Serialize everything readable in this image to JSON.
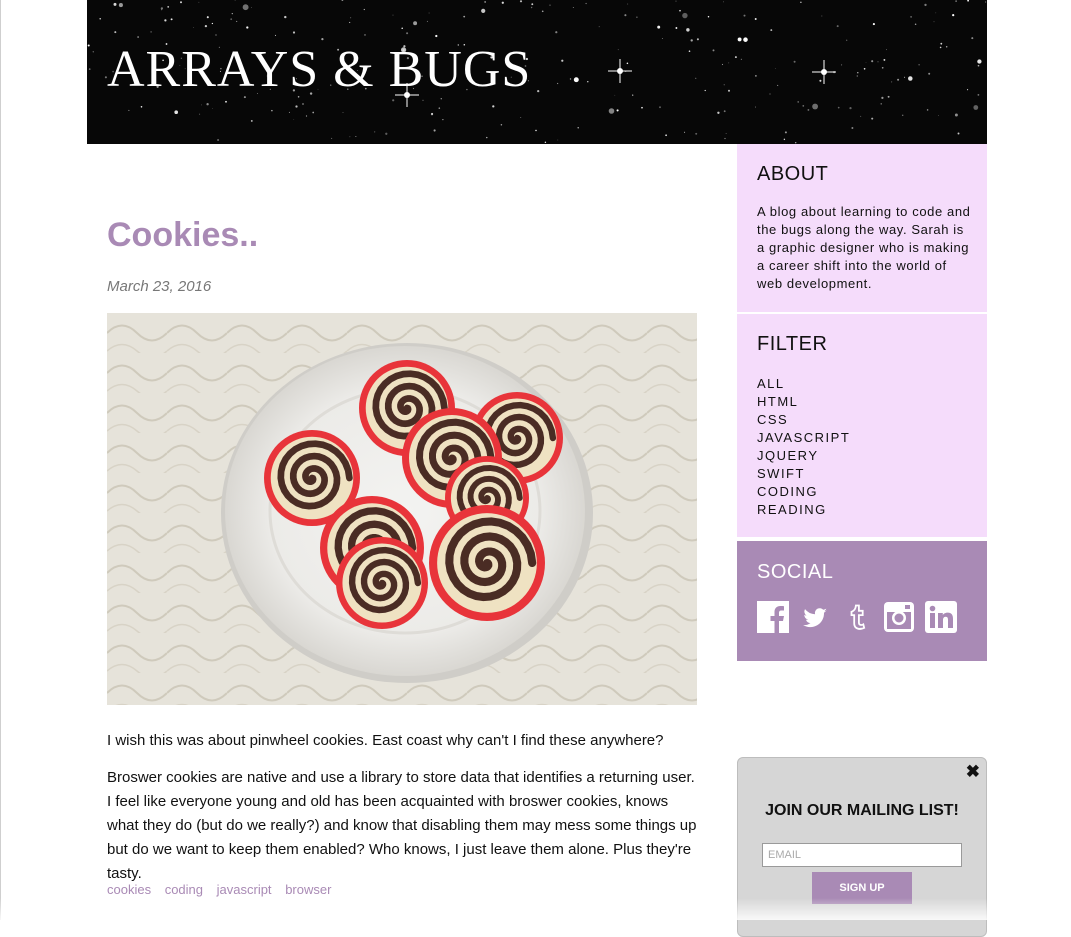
{
  "header": {
    "title": "ARRAYS & BUGS"
  },
  "post": {
    "title": "Cookies..",
    "date": "March 23, 2016",
    "image_alt": "pinwheel cookies on a white plate",
    "paragraphs": [
      "I wish this was about pinwheel cookies. East coast why can't I find these anywhere?",
      "Broswer cookies are native and use a library to store data that identifies a returning user. I feel like everyone young and old has been acquainted with broswer cookies, knows what they do (but do we really?) and know that disabling them may mess some things up but do we want to keep them enabled? Who knows, I just leave them alone. Plus they're tasty."
    ],
    "tags": [
      "cookies",
      "coding",
      "javascript",
      "browser"
    ]
  },
  "sidebar": {
    "about": {
      "heading": "ABOUT",
      "text": "A blog about learning to code and the bugs along the way. Sarah is a graphic designer who is making a career shift into the world of web development."
    },
    "filter": {
      "heading": "FILTER",
      "items": [
        "ALL",
        "HTML",
        "CSS",
        "JAVASCRIPT",
        "JQUERY",
        "SWIFT",
        "CODING",
        "READING"
      ]
    },
    "social": {
      "heading": "SOCIAL",
      "icons": [
        "facebook-icon",
        "twitter-icon",
        "tumblr-icon",
        "instagram-icon",
        "linkedin-icon"
      ]
    }
  },
  "mailing": {
    "close": "✖",
    "heading": "JOIN OUR MAILING LIST!",
    "email_placeholder": "EMAIL",
    "button_label": "SIGN UP"
  },
  "colors": {
    "accent": "#a98ab5",
    "panel": "#f5dcfb",
    "popup": "#d6d6d6"
  }
}
